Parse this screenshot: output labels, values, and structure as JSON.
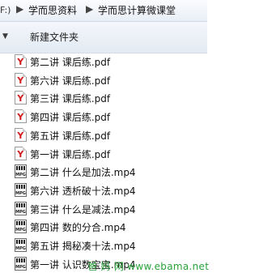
{
  "breadcrumb": {
    "edge": "F:)",
    "items": [
      "学而思资料",
      "学而思计算微课堂"
    ],
    "separator": "▶"
  },
  "toolbar": {
    "menu_arrow": "▼",
    "new_folder": "新建文件夹"
  },
  "files": [
    {
      "name": "第二讲 课后练.pdf",
      "type": "pdf",
      "icon": "pdf-file-icon"
    },
    {
      "name": "第六讲 课后练.pdf",
      "type": "pdf",
      "icon": "pdf-file-icon"
    },
    {
      "name": "第三讲 课后练.pdf",
      "type": "pdf",
      "icon": "pdf-file-icon"
    },
    {
      "name": "第四讲 课后练.pdf",
      "type": "pdf",
      "icon": "pdf-file-icon"
    },
    {
      "name": "第五讲 课后练.pdf",
      "type": "pdf",
      "icon": "pdf-file-icon"
    },
    {
      "name": "第一讲 课后练.pdf",
      "type": "pdf",
      "icon": "pdf-file-icon"
    },
    {
      "name": "第二讲 什么是加法.mp4",
      "type": "mp4",
      "icon": "video-file-icon"
    },
    {
      "name": "第六讲 透析破十法.mp4",
      "type": "mp4",
      "icon": "video-file-icon"
    },
    {
      "name": "第三讲 什么是减法.mp4",
      "type": "mp4",
      "icon": "video-file-icon"
    },
    {
      "name": "第四讲 数的分合.mp4",
      "type": "mp4",
      "icon": "video-file-icon"
    },
    {
      "name": "第五讲 揭秘凑十法.mp4",
      "type": "mp4",
      "icon": "video-file-icon"
    },
    {
      "name": "第一讲 认识数宝宝.mp4",
      "type": "mp4",
      "icon": "video-file-icon"
    }
  ],
  "video_icon_label": "MPG",
  "watermark": "爸 妈 网  www.ebama.net"
}
